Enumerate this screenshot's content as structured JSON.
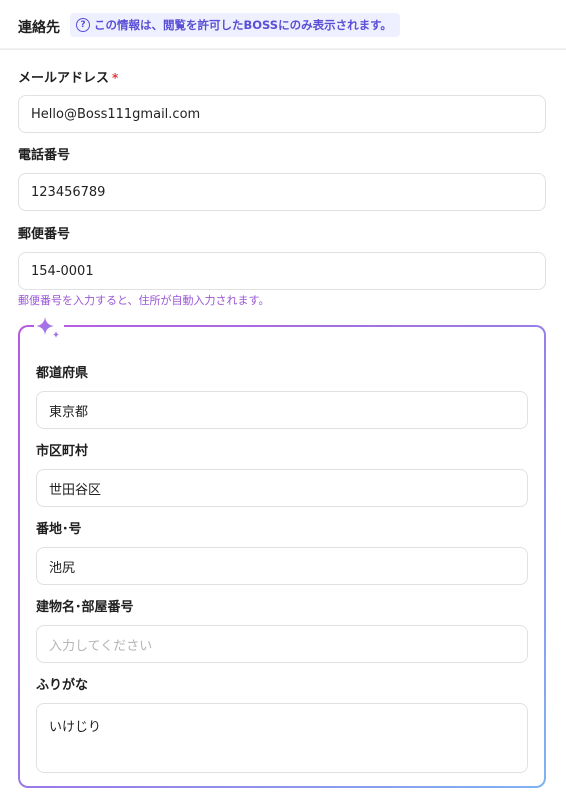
{
  "header": {
    "title": "連絡先",
    "privacy_notice": "この情報は、閲覧を許可したBOSSにのみ表示されます。",
    "badge_color": "#5b4fd6"
  },
  "fields": {
    "email": {
      "label": "メールアドレス",
      "required_mark": "*",
      "value": "Hello@Boss111gmail.com"
    },
    "phone": {
      "label": "電話番号",
      "value": "123456789"
    },
    "postal": {
      "label": "郵便番号",
      "value": "154-0001",
      "hint": "郵便番号を入力すると、住所が自動入力されます。"
    }
  },
  "address": {
    "prefecture": {
      "label": "都道府県",
      "value": "東京都"
    },
    "city": {
      "label": "市区町村",
      "value": "世田谷区"
    },
    "block": {
      "label": "番地･号",
      "value": "池尻"
    },
    "building": {
      "label": "建物名･部屋番号",
      "placeholder": "入力してください"
    },
    "furigana": {
      "label": "ふりがな",
      "value": "いけじり"
    }
  },
  "colors": {
    "ai_gradient_start": "#b55ce0",
    "ai_gradient_end": "#7fb3f2",
    "hint": "#9a56d6",
    "required": "#e03a3a"
  },
  "icons": {
    "help": "question-circle-icon",
    "ai": "sparkle-icon"
  }
}
